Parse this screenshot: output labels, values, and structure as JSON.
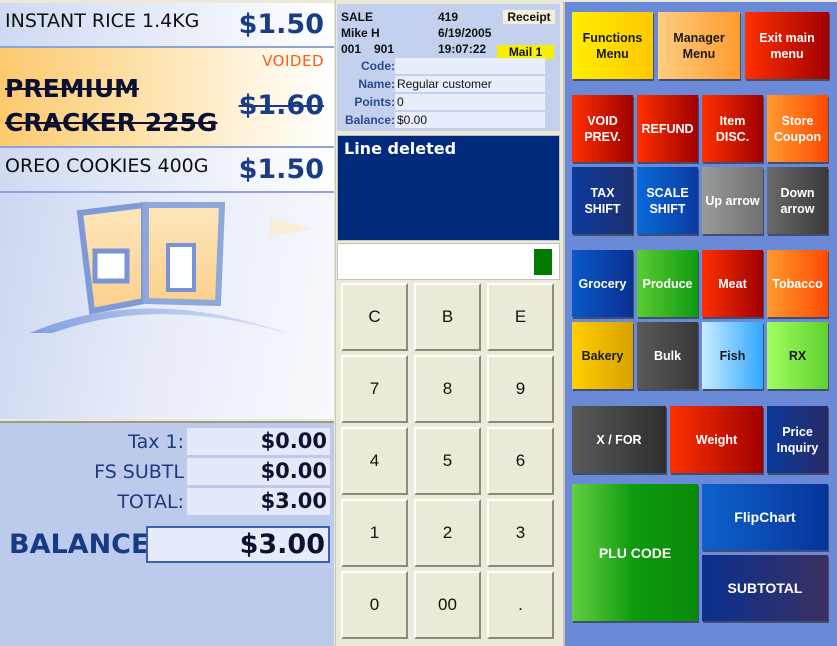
{
  "items": [
    {
      "name": "INSTANT RICE 1.4KG",
      "price": "$1.50",
      "status": ""
    },
    {
      "name": "PREMIUM CRACKER 225G",
      "price": "$1.60",
      "status": "VOIDED"
    },
    {
      "name": "OREO COOKIES 400G",
      "price": "$1.50",
      "status": ""
    }
  ],
  "totals": {
    "tax1_label": "Tax 1:",
    "tax1_value": "$0.00",
    "fs_subtl_label": "FS SUBTL",
    "fs_subtl_value": "$0.00",
    "total_label": "TOTAL:",
    "total_value": "$3.00",
    "balance_label": "BALANCE",
    "balance_value": "$3.00"
  },
  "header": {
    "mode": "SALE",
    "transaction_no": "419",
    "receipt_label": "Receipt",
    "cashier": "Mike H",
    "date": "6/19/2005",
    "store": "001",
    "terminal": "901",
    "time": "19:07:22",
    "mail_label": "Mail 1"
  },
  "customer": {
    "code_label": "Code:",
    "code_value": "",
    "name_label": "Name:",
    "name_value": "Regular customer",
    "points_label": "Points:",
    "points_value": "0",
    "balance_label": "Balance:",
    "balance_value": "$0.00"
  },
  "message": "Line deleted",
  "entry_value": "",
  "indicator_color": "#007a00",
  "keypad": [
    "C",
    "B",
    "E",
    "7",
    "8",
    "9",
    "4",
    "5",
    "6",
    "1",
    "2",
    "3",
    "0",
    "00",
    "."
  ],
  "menu_buttons": {
    "functions": "Functions Menu",
    "manager": "Manager Menu",
    "exit": "Exit main menu"
  },
  "function_buttons": {
    "void_prev": "VOID PREV.",
    "refund": "REFUND",
    "item_disc": "Item DISC.",
    "store_coupon": "Store Coupon",
    "tax_shift": "TAX SHIFT",
    "scale_shift": "SCALE SHIFT",
    "up_arrow": "Up arrow",
    "down_arrow": "Down arrow"
  },
  "department_buttons": {
    "grocery": "Grocery",
    "produce": "Produce",
    "meat": "Meat",
    "tobacco": "Tobacco",
    "bakery": "Bakery",
    "bulk": "Bulk",
    "fish": "Fish",
    "rx": "RX"
  },
  "action_buttons": {
    "x_for": "X / FOR",
    "weight": "Weight",
    "price_inquiry": "Price Inquiry",
    "plu_code": "PLU CODE",
    "flipchart": "FlipChart",
    "subtotal": "SUBTOTAL"
  }
}
